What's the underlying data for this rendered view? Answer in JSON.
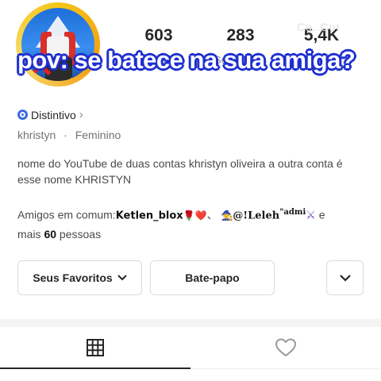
{
  "caption": "pov: se batece na sua amiga?",
  "watermark": "Ca..Cut",
  "stats": [
    {
      "value": "603",
      "label": "Seguindo"
    },
    {
      "value": "283",
      "label": "Seguidores"
    },
    {
      "value": "5,4K",
      "label": "Curtidas"
    }
  ],
  "badge": {
    "label": "Distintivo",
    "chevron": "›"
  },
  "meta": {
    "username": "khristyn",
    "separator": "·",
    "gender": "Feminino"
  },
  "bio": "nome do YouTube de duas contas khristyn oliveira a outra conta é esse nome KHRISTYN",
  "mutual": {
    "prefix": "Amigos em comum:",
    "friend1": "Ketlen_blox",
    "friend1_emoji": "🌹❤️",
    "sep": "、",
    "friend2_emoji": "🧙",
    "friend2": "@!Leleh",
    "friend2_sup": "\"admi",
    "friend2_tail": "⚔",
    "suffix_pre": "e",
    "suffix_mid": "mais",
    "count": "60",
    "suffix_post": "pessoas"
  },
  "buttons": {
    "favorites": "Seus Favoritos",
    "favorites_chevron": "⌄",
    "chat": "Bate-papo",
    "more": "⌄"
  },
  "tabs": {
    "grid": "grid-icon",
    "liked": "heart-icon"
  },
  "colors": {
    "caption_outline": "#1e2fd0",
    "badge_blue": "#3d6ae0",
    "avatar_ring": "#f5c518"
  }
}
